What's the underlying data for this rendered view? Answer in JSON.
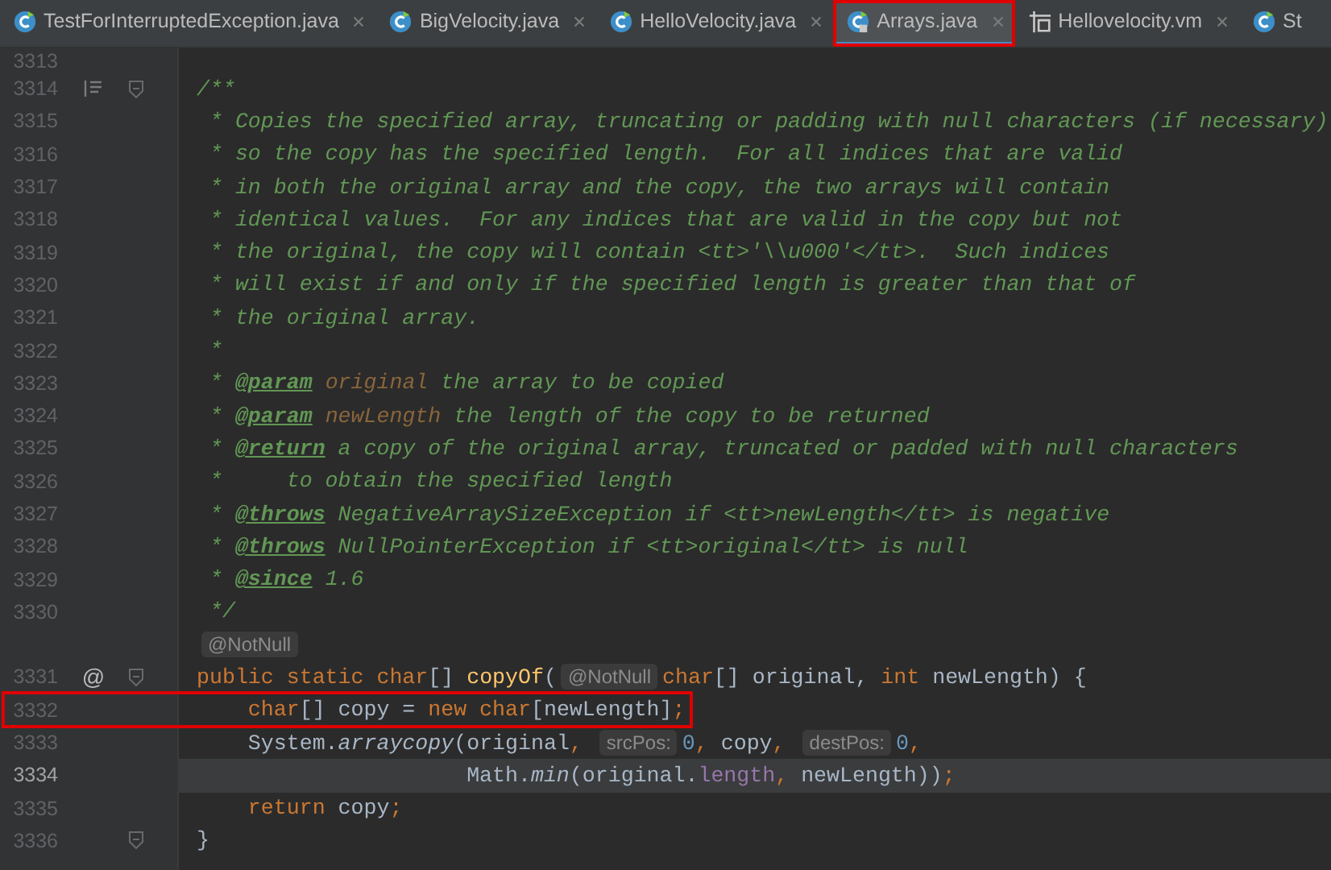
{
  "tabs": [
    {
      "label": "TestForInterruptedException.java",
      "kind": "java",
      "selected": false,
      "outlined": false,
      "closable": true
    },
    {
      "label": "BigVelocity.java",
      "kind": "java",
      "selected": false,
      "outlined": false,
      "closable": true
    },
    {
      "label": "HelloVelocity.java",
      "kind": "java",
      "selected": false,
      "outlined": false,
      "closable": true
    },
    {
      "label": "Arrays.java",
      "kind": "java-readonly",
      "selected": true,
      "outlined": true,
      "closable": true
    },
    {
      "label": "Hellovelocity.vm",
      "kind": "template",
      "selected": false,
      "outlined": false,
      "closable": true
    },
    {
      "label": "St",
      "kind": "java",
      "selected": false,
      "outlined": false,
      "closable": false
    }
  ],
  "editor": {
    "top_number": "3313",
    "lines": [
      {
        "number": "3314",
        "doc_toggle": true,
        "fold": true,
        "current": false,
        "outlined": false,
        "tokens": [
          {
            "kind": "comment",
            "text": "/**"
          }
        ]
      },
      {
        "number": "3315",
        "doc_toggle": false,
        "fold": false,
        "current": false,
        "outlined": false,
        "tokens": [
          {
            "kind": "comment",
            "text": " * Copies the specified array, truncating or padding with null characters (if necessary)"
          }
        ]
      },
      {
        "number": "3316",
        "doc_toggle": false,
        "fold": false,
        "current": false,
        "outlined": false,
        "tokens": [
          {
            "kind": "comment",
            "text": " * so the copy has the specified length.  For all indices that are valid"
          }
        ]
      },
      {
        "number": "3317",
        "doc_toggle": false,
        "fold": false,
        "current": false,
        "outlined": false,
        "tokens": [
          {
            "kind": "comment",
            "text": " * in both the original array and the copy, the two arrays will contain"
          }
        ]
      },
      {
        "number": "3318",
        "doc_toggle": false,
        "fold": false,
        "current": false,
        "outlined": false,
        "tokens": [
          {
            "kind": "comment",
            "text": " * identical values.  For any indices that are valid in the copy but not"
          }
        ]
      },
      {
        "number": "3319",
        "doc_toggle": false,
        "fold": false,
        "current": false,
        "outlined": false,
        "tokens": [
          {
            "kind": "comment",
            "text": " * the original, the copy will contain <tt>'\\\\u000'</tt>.  Such indices"
          }
        ]
      },
      {
        "number": "3320",
        "doc_toggle": false,
        "fold": false,
        "current": false,
        "outlined": false,
        "tokens": [
          {
            "kind": "comment",
            "text": " * will exist if and only if the specified length is greater than that of"
          }
        ]
      },
      {
        "number": "3321",
        "doc_toggle": false,
        "fold": false,
        "current": false,
        "outlined": false,
        "tokens": [
          {
            "kind": "comment",
            "text": " * the original array."
          }
        ]
      },
      {
        "number": "3322",
        "doc_toggle": false,
        "fold": false,
        "current": false,
        "outlined": false,
        "tokens": [
          {
            "kind": "comment",
            "text": " *"
          }
        ]
      },
      {
        "number": "3323",
        "doc_toggle": false,
        "fold": false,
        "current": false,
        "outlined": false,
        "tokens": [
          {
            "kind": "comment",
            "text": " * "
          },
          {
            "kind": "doctag",
            "text": "@param"
          },
          {
            "kind": "docparam",
            "text": " original"
          },
          {
            "kind": "comment",
            "text": " the array to be copied"
          }
        ]
      },
      {
        "number": "3324",
        "doc_toggle": false,
        "fold": false,
        "current": false,
        "outlined": false,
        "tokens": [
          {
            "kind": "comment",
            "text": " * "
          },
          {
            "kind": "doctag",
            "text": "@param"
          },
          {
            "kind": "docparam",
            "text": " newLength"
          },
          {
            "kind": "comment",
            "text": " the length of the copy to be returned"
          }
        ]
      },
      {
        "number": "3325",
        "doc_toggle": false,
        "fold": false,
        "current": false,
        "outlined": false,
        "tokens": [
          {
            "kind": "comment",
            "text": " * "
          },
          {
            "kind": "doctag",
            "text": "@return"
          },
          {
            "kind": "comment",
            "text": " a copy of the original array, truncated or padded with null characters"
          }
        ]
      },
      {
        "number": "3326",
        "doc_toggle": false,
        "fold": false,
        "current": false,
        "outlined": false,
        "tokens": [
          {
            "kind": "comment",
            "text": " *     to obtain the specified length"
          }
        ]
      },
      {
        "number": "3327",
        "doc_toggle": false,
        "fold": false,
        "current": false,
        "outlined": false,
        "tokens": [
          {
            "kind": "comment",
            "text": " * "
          },
          {
            "kind": "doctag",
            "text": "@throws"
          },
          {
            "kind": "docref",
            "text": " NegativeArraySizeException"
          },
          {
            "kind": "comment",
            "text": " if <tt>newLength</tt> is negative"
          }
        ]
      },
      {
        "number": "3328",
        "doc_toggle": false,
        "fold": false,
        "current": false,
        "outlined": false,
        "tokens": [
          {
            "kind": "comment",
            "text": " * "
          },
          {
            "kind": "doctag",
            "text": "@throws"
          },
          {
            "kind": "docref",
            "text": " NullPointerException"
          },
          {
            "kind": "comment",
            "text": " if <tt>original</tt> is null"
          }
        ]
      },
      {
        "number": "3329",
        "doc_toggle": false,
        "fold": false,
        "current": false,
        "outlined": false,
        "tokens": [
          {
            "kind": "comment",
            "text": " * "
          },
          {
            "kind": "doctag",
            "text": "@since"
          },
          {
            "kind": "comment",
            "text": " 1.6"
          }
        ]
      },
      {
        "number": "3330",
        "doc_toggle": false,
        "fold": false,
        "current": false,
        "outlined": false,
        "tokens": [
          {
            "kind": "comment",
            "text": " */"
          }
        ]
      },
      {
        "doc_toggle": false,
        "fold": false,
        "current": false,
        "outlined": false,
        "tokens": [
          {
            "kind": "hint",
            "text": "@NotNull"
          }
        ]
      },
      {
        "number": "3331",
        "marker": "@",
        "doc_toggle": false,
        "fold": true,
        "current": false,
        "outlined": false,
        "tokens": [
          {
            "kind": "keyword",
            "text": "public static char"
          },
          {
            "kind": "plain",
            "text": "[] "
          },
          {
            "kind": "method",
            "text": "copyOf"
          },
          {
            "kind": "plain",
            "text": "("
          },
          {
            "kind": "hint",
            "text": "@NotNull"
          },
          {
            "kind": "keyword",
            "text": "char"
          },
          {
            "kind": "plain",
            "text": "[] original, "
          },
          {
            "kind": "keyword",
            "text": "int"
          },
          {
            "kind": "plain",
            "text": " newLength) {"
          }
        ]
      },
      {
        "number": "3332",
        "doc_toggle": false,
        "fold": false,
        "current": false,
        "outlined": true,
        "tokens": [
          {
            "kind": "keyword",
            "text": "    char"
          },
          {
            "kind": "plain",
            "text": "[] copy = "
          },
          {
            "kind": "keyword",
            "text": "new char"
          },
          {
            "kind": "plain",
            "text": "[newLength]"
          },
          {
            "kind": "keyword",
            "text": ";"
          }
        ]
      },
      {
        "number": "3333",
        "doc_toggle": false,
        "fold": false,
        "current": false,
        "outlined": false,
        "tokens": [
          {
            "kind": "plain",
            "text": "    System."
          },
          {
            "kind": "static",
            "text": "arraycopy"
          },
          {
            "kind": "plain",
            "text": "(original"
          },
          {
            "kind": "keyword",
            "text": ", "
          },
          {
            "kind": "hint",
            "text": "srcPos:"
          },
          {
            "kind": "number",
            "text": "0"
          },
          {
            "kind": "keyword",
            "text": ","
          },
          {
            "kind": "plain",
            "text": " copy"
          },
          {
            "kind": "keyword",
            "text": ", "
          },
          {
            "kind": "hint",
            "text": "destPos:"
          },
          {
            "kind": "number",
            "text": "0"
          },
          {
            "kind": "keyword",
            "text": ","
          }
        ]
      },
      {
        "number": "3334",
        "doc_toggle": false,
        "fold": false,
        "current": true,
        "outlined": false,
        "tokens": [
          {
            "kind": "plain",
            "text": "                     Math."
          },
          {
            "kind": "static",
            "text": "min"
          },
          {
            "kind": "plain",
            "text": "(original."
          },
          {
            "kind": "field",
            "text": "length"
          },
          {
            "kind": "keyword",
            "text": ","
          },
          {
            "kind": "plain",
            "text": " newLength))"
          },
          {
            "kind": "keyword",
            "text": ";"
          }
        ]
      },
      {
        "number": "3335",
        "doc_toggle": false,
        "fold": false,
        "current": false,
        "outlined": false,
        "tokens": [
          {
            "kind": "keyword",
            "text": "    return"
          },
          {
            "kind": "plain",
            "text": " copy"
          },
          {
            "kind": "keyword",
            "text": ";"
          }
        ]
      },
      {
        "number": "3336",
        "doc_toggle": false,
        "fold": true,
        "current": false,
        "outlined": false,
        "tokens": [
          {
            "kind": "plain",
            "text": "}"
          }
        ]
      }
    ]
  }
}
